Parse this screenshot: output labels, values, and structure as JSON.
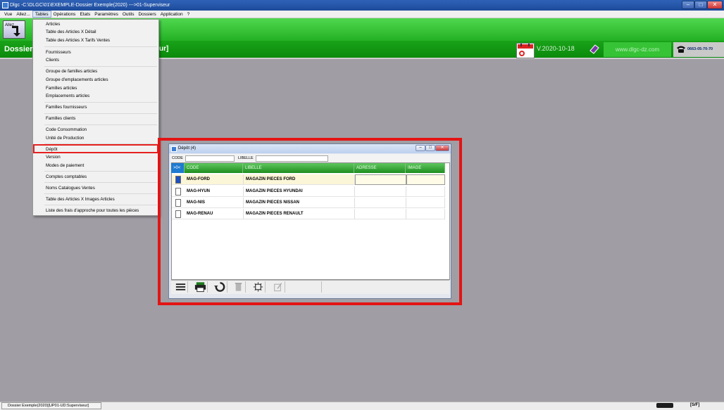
{
  "window": {
    "title": "Dlgc -C:\\DLGC\\01\\EXEMPLE-Dossier Exemple(2020) --->01-Superviseur",
    "minimize": "–",
    "maximize": "□",
    "close": "✕"
  },
  "menubar": [
    "Vue",
    "Allez...",
    "Tables",
    "Opérations",
    "Etats",
    "Paramètres",
    "Outils",
    "Dossiers",
    "Application",
    "?"
  ],
  "toolbar": {
    "allez_label": "Allez..."
  },
  "infobar": {
    "dossier": "Dossier",
    "utilisateur_tail": "ur]",
    "version": "V.2020-10-18",
    "website": "www.dlgc-dz.com",
    "phone": "0663-05-70-70"
  },
  "tables_menu": {
    "items": [
      "Articles",
      "Table des Articles X Détail",
      "Table des Articles X Tarifs Ventes",
      "Fournisseurs",
      "Clients",
      "Groupe de familles articles",
      "Groupe d'emplacements articles",
      "Familles articles",
      "Emplacements articles",
      "Familles fournisseurs",
      "Familles clients",
      "Code Consommation",
      "Unité de Production",
      "Dépôt",
      "Version",
      "Modes de paiement",
      "Comptes comptables",
      "Noms Catalogues Ventes",
      "Table des Articles X Images Articles",
      "Liste des frais d'approche pour toutes les pièces"
    ]
  },
  "depot_window": {
    "title": "Dépôt (4)",
    "filter": {
      "code_label": "CODE",
      "libelle_label": "LIBELLE",
      "code_value": "",
      "libelle_value": ""
    },
    "columns": [
      ">0<",
      "CODE",
      "LIBELLE",
      "ADRESSE",
      "IMAGE"
    ],
    "rows": [
      {
        "code": "MAG-FORD",
        "libelle": "MAGAZIN PIECES FORD",
        "adresse": "",
        "image": ""
      },
      {
        "code": "MAG-HYUN",
        "libelle": "MAGAZIN PIECES HYUNDAI",
        "adresse": "",
        "image": ""
      },
      {
        "code": "MAG-NIS",
        "libelle": "MAGAZIN PIECES NISSAN",
        "adresse": "",
        "image": ""
      },
      {
        "code": "MAG-RENAU",
        "libelle": "MAGAZIN PIECES RENAULT",
        "adresse": "",
        "image": ""
      }
    ],
    "selected_row": 0,
    "toolbar_icons": [
      "menu-icon",
      "print-icon",
      "refresh-icon",
      "delete-icon",
      "settings-icon",
      "edit-icon"
    ]
  },
  "statusbar": {
    "left": "Dossier Exemple(2020)[UP01-UD:Superviseur]",
    "right": "[S/F]"
  },
  "colors": {
    "accent_green": "#1e8e1e",
    "highlight_red": "#e31414"
  }
}
